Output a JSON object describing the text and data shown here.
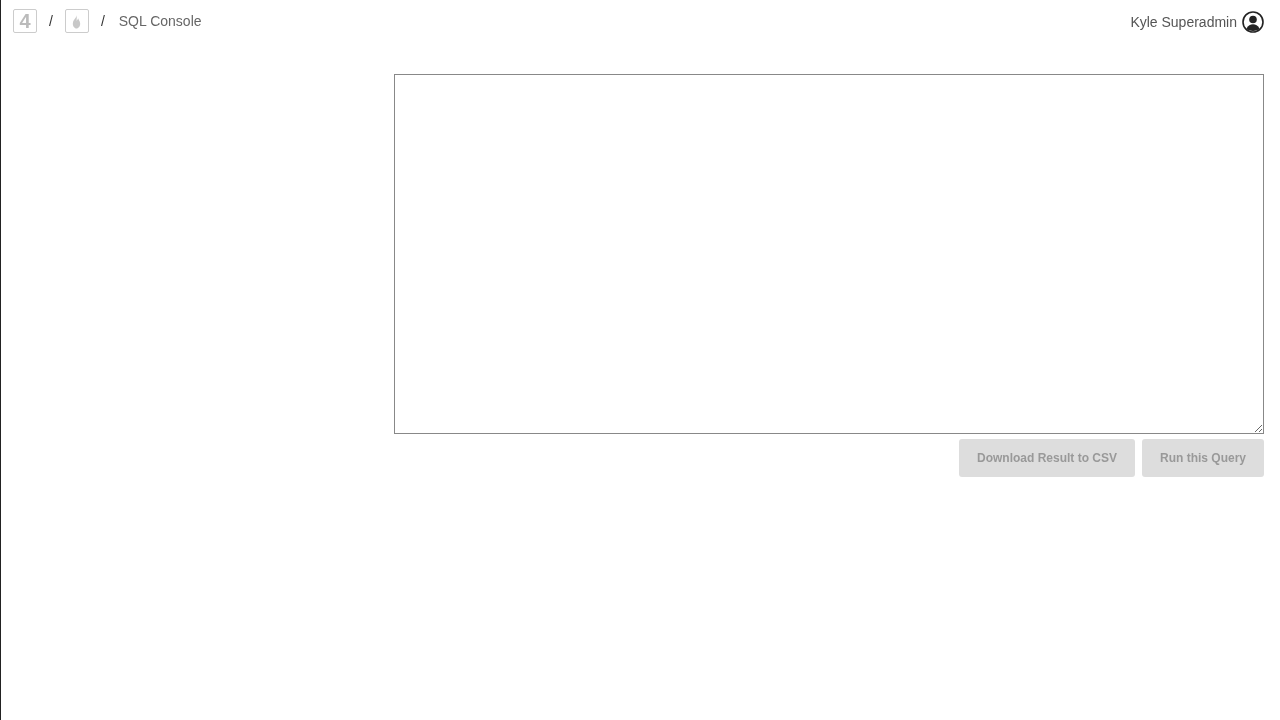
{
  "breadcrumb": {
    "logo": "4",
    "separators": [
      "/",
      "/"
    ],
    "page": "SQL Console"
  },
  "user": {
    "name": "Kyle Superadmin"
  },
  "buttons": [
    {
      "label": "Download Result to CSV",
      "disabled": true
    },
    {
      "label": "Run this Query",
      "disabled": true
    }
  ]
}
